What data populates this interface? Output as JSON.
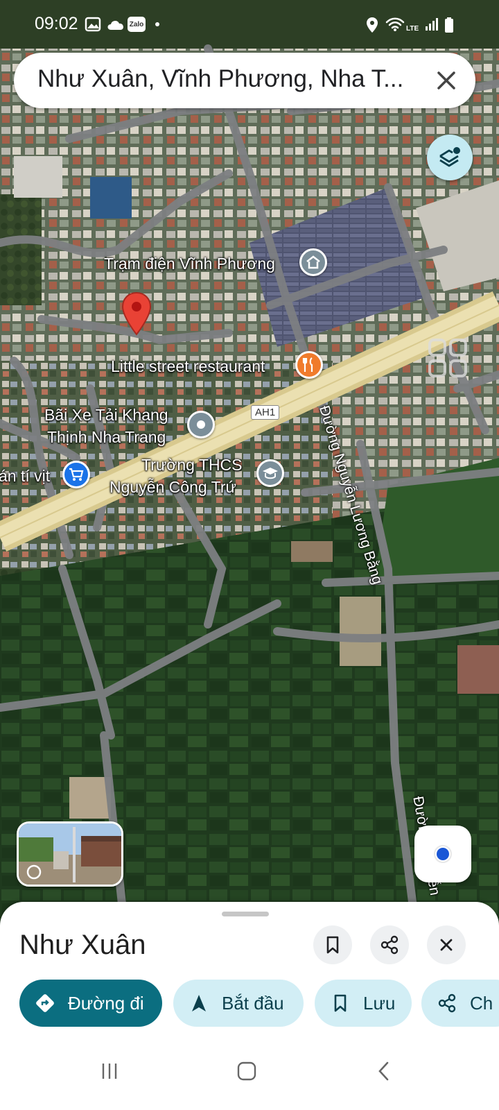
{
  "status_bar": {
    "time": "09:02",
    "notification_icons": [
      "image-icon",
      "cloud-icon",
      "zalo-icon",
      "dot-icon"
    ],
    "zalo_label": "Zalo",
    "system_icons": [
      "location-icon",
      "wifi-icon",
      "lte-icon",
      "signal-icon",
      "battery-icon"
    ],
    "lte_label": "LTE"
  },
  "search": {
    "text": "Như Xuân, Vĩnh Phương, Nha T...",
    "close_icon": "close-icon"
  },
  "map": {
    "labels": {
      "substation": "Trạm điện Vĩnh Phương",
      "restaurant": "Little street restaurant",
      "truck_park_line1": "Bãi Xe Tải Khang",
      "truck_park_line2": "Thịnh Nha Trang",
      "school_line1": "Trường THCS",
      "school_line2": "Nguyễn Công Trứ",
      "shop": "án tí vịt",
      "road_shield": "AH1",
      "street_1": "Đường Nguyễn Lương Bằng",
      "street_2": "Đường Nguyễn"
    },
    "colors": {
      "pin_red": "#e94235",
      "poi_gray": "#7b8e99",
      "poi_orange": "#f07b2c",
      "poi_blue": "#1a73e8",
      "highway": "#e8d9a0"
    }
  },
  "controls": {
    "layers_icon": "layers-icon",
    "my_location_icon": "my-location-icon",
    "street_view_icon": "street-view-thumbnail"
  },
  "sheet": {
    "title": "Như Xuân",
    "actions": {
      "directions": "Đường đi",
      "start": "Bắt đầu",
      "save": "Lưu",
      "share": "Ch"
    },
    "icon_buttons": [
      "bookmark-icon",
      "share-icon",
      "close-icon"
    ]
  },
  "nav_bar": {
    "buttons": [
      "recent-apps-icon",
      "home-icon",
      "back-icon"
    ]
  }
}
